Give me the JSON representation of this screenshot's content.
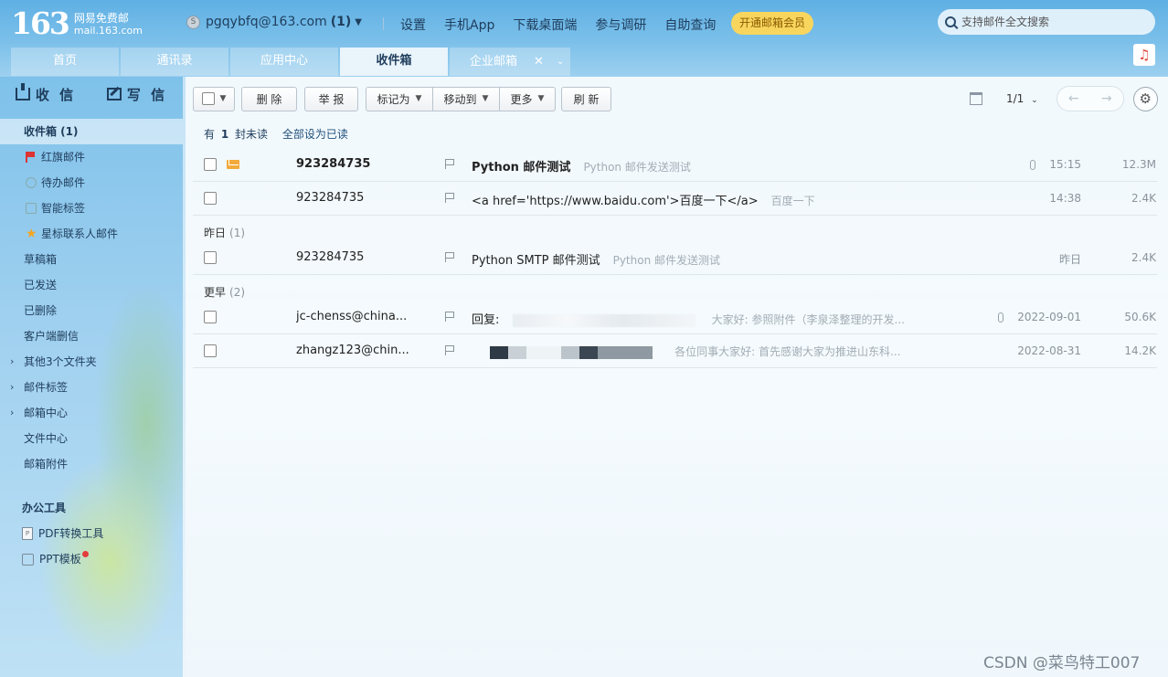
{
  "header": {
    "logo_number": "163",
    "logo_line1": "网易免费邮",
    "logo_line2": "mail.163.com",
    "account_email": "pgqybfq@163.com",
    "account_count": "(1)",
    "nav": [
      "设置",
      "手机App",
      "下载桌面端",
      "参与调研",
      "自助查询"
    ],
    "vip_button": "开通邮箱会员",
    "search_placeholder": "支持邮件全文搜索",
    "tabs": [
      "首页",
      "通讯录",
      "应用中心",
      "收件箱",
      "企业邮箱"
    ],
    "active_tab": "收件箱",
    "music_icon": "music-note-icon"
  },
  "sidebar": {
    "receive": "收 信",
    "compose": "写 信",
    "items": [
      {
        "label": "收件箱 (1)",
        "icon": ""
      },
      {
        "label": "红旗邮件",
        "icon": "red-flag-icon"
      },
      {
        "label": "待办邮件",
        "icon": "clock-icon"
      },
      {
        "label": "智能标签",
        "icon": "tag-icon"
      },
      {
        "label": "星标联系人邮件",
        "icon": "star-icon"
      },
      {
        "label": "草稿箱",
        "icon": ""
      },
      {
        "label": "已发送",
        "icon": ""
      },
      {
        "label": "已删除",
        "icon": ""
      },
      {
        "label": "客户端删信",
        "icon": ""
      },
      {
        "label": "其他3个文件夹",
        "icon": "chevron-right-icon"
      },
      {
        "label": "邮件标签",
        "icon": "chevron-right-icon"
      },
      {
        "label": "邮箱中心",
        "icon": "chevron-right-icon"
      },
      {
        "label": "文件中心",
        "icon": ""
      },
      {
        "label": "邮箱附件",
        "icon": ""
      }
    ],
    "tools_title": "办公工具",
    "tools": [
      "PDF转换工具",
      "PPT模板"
    ]
  },
  "toolbar": {
    "delete": "删 除",
    "report": "举 报",
    "mark_as": "标记为",
    "move_to": "移动到",
    "more": "更多",
    "refresh": "刷 新",
    "page": "1/1"
  },
  "unread": {
    "prefix": "有",
    "count": "1",
    "suffix": "封未读",
    "mark_all": "全部设为已读"
  },
  "groups": {
    "yesterday": {
      "label": "昨日",
      "count": "(1)"
    },
    "earlier": {
      "label": "更早",
      "count": "(2)"
    }
  },
  "mails": [
    {
      "sender": "923284735",
      "subject": "Python 邮件测试",
      "preview": "Python 邮件发送测试",
      "time": "15:15",
      "size": "12.3M",
      "unread": true,
      "attachment": true
    },
    {
      "sender": "923284735",
      "subject": "<a href='https://www.baidu.com'>百度一下</a>",
      "preview": "百度一下",
      "time": "14:38",
      "size": "2.4K",
      "unread": false,
      "attachment": false
    },
    {
      "sender": "923284735",
      "subject": "Python SMTP 邮件测试",
      "preview": "Python 邮件发送测试",
      "time": "昨日",
      "size": "2.4K",
      "unread": false,
      "attachment": false
    },
    {
      "sender": "jc-chenss@china...",
      "subject": "回复:",
      "preview": "大家好:   参照附件（李泉泽整理的开发...",
      "time": "2022-09-01",
      "size": "50.6K",
      "unread": false,
      "attachment": true
    },
    {
      "sender": "zhangz123@chin...",
      "subject": "",
      "preview": "各位同事大家好:   首先感谢大家为推进山东科...",
      "time": "2022-08-31",
      "size": "14.2K",
      "unread": false,
      "attachment": false
    }
  ],
  "watermark": "CSDN @菜鸟特工007"
}
